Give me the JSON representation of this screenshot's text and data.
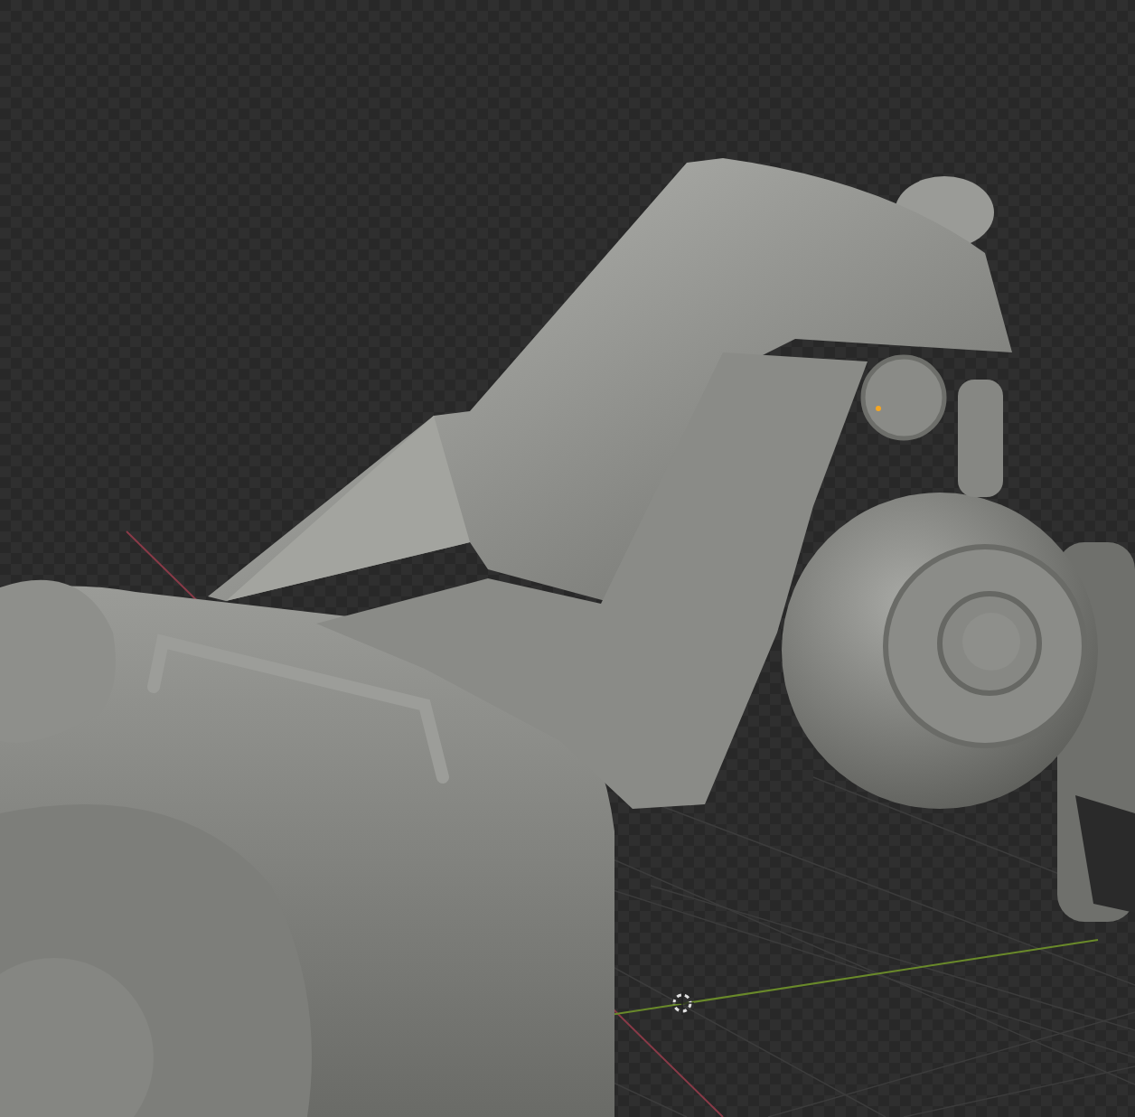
{
  "viewport": {
    "show_floor_grid": true,
    "show_axes": true,
    "show_3d_cursor": true,
    "show_origin": true
  }
}
